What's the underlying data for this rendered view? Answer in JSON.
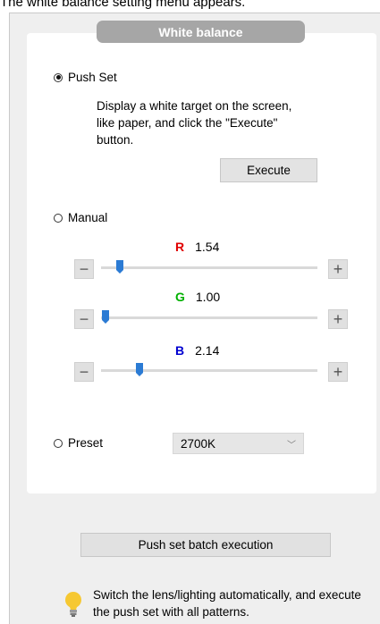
{
  "caption": "The white balance setting menu appears.",
  "panel_title": "White balance",
  "push_set": {
    "label": "Push Set",
    "selected": true,
    "description": "Display a white target on the screen, like paper, and click the \"Execute\" button.",
    "execute_label": "Execute"
  },
  "manual": {
    "label": "Manual",
    "selected": false,
    "channels": [
      {
        "letter": "R",
        "value": "1.54",
        "color": "#e00000",
        "level": 0.1
      },
      {
        "letter": "G",
        "value": "1.00",
        "color": "#00b000",
        "level": 0.0
      },
      {
        "letter": "B",
        "value": "2.14",
        "color": "#0000d0",
        "level": 0.19
      }
    ],
    "minus": "−",
    "plus": "+"
  },
  "preset": {
    "label": "Preset",
    "selected": false,
    "value": "2700K"
  },
  "batch_button_label": "Push set batch execution",
  "tip": "Switch the lens/lighting automatically, and execute the push set with all patterns.",
  "colors": {
    "thumb": "#2b7bd4",
    "bulb": "#f6c832"
  }
}
